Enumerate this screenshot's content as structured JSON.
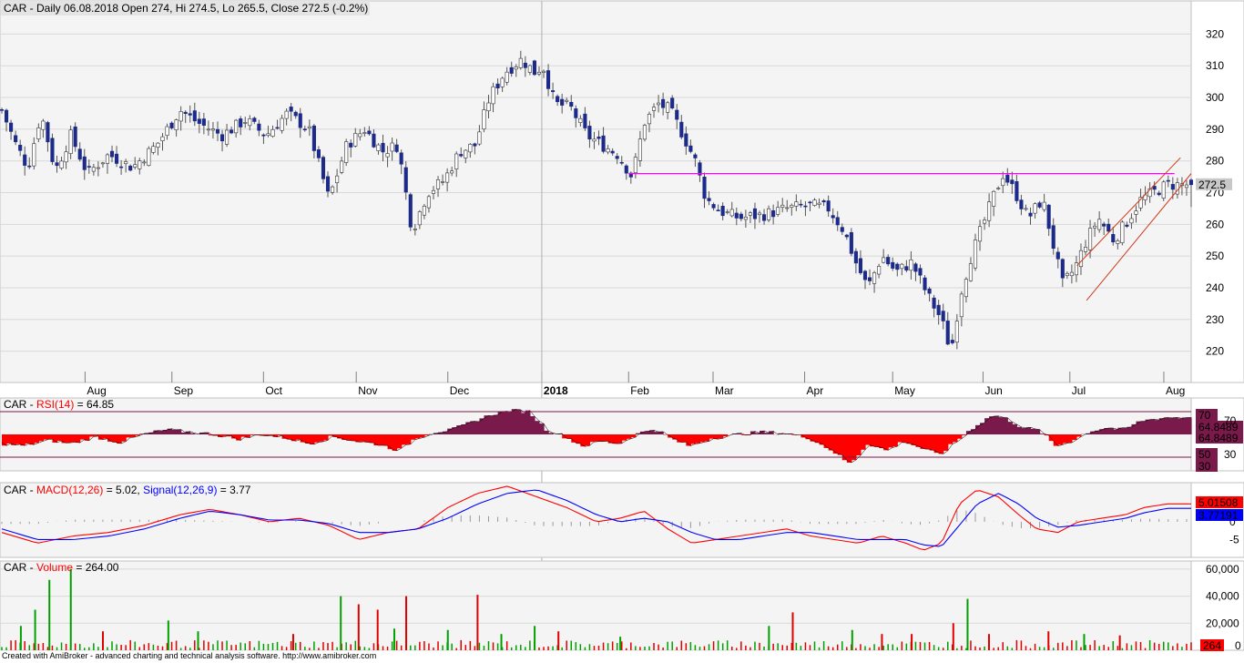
{
  "footer": {
    "text": "Created with AmiBroker - advanced charting and technical analysis software. http://www.amibroker.com"
  },
  "colors": {
    "bg": "#ffffff",
    "pane_bg": "#f4f4f4",
    "grid": "#d8d8d8",
    "candle_down": "#1c2a8a",
    "candle_up": "#ffffff",
    "wick": "#555555",
    "resistance": "#ff00ff",
    "channel": "#d03a1a",
    "rsi_fill_high": "#7a1a4a",
    "rsi_fill_low": "#ff0000",
    "macd": "#ff0000",
    "signal": "#0000ff",
    "vol_up": "#00a000",
    "vol_down": "#e00000"
  },
  "chart_data": [
    {
      "id": "price",
      "type": "candlestick",
      "title_parts": [
        {
          "text": "CAR - Daily 06.08.2018 Open 274, Hi 274.5, Lo 265.5, Close 272.5 (-0.2%)",
          "color": "#000000"
        }
      ],
      "ylim": [
        213,
        325
      ],
      "yticks": [
        220,
        230,
        240,
        250,
        260,
        270,
        280,
        290,
        300,
        310,
        320
      ],
      "months": [
        {
          "label": "Aug",
          "bold": false,
          "frac": 0.07
        },
        {
          "label": "Sep",
          "bold": false,
          "frac": 0.143
        },
        {
          "label": "Oct",
          "bold": false,
          "frac": 0.22
        },
        {
          "label": "Nov",
          "bold": false,
          "frac": 0.298
        },
        {
          "label": "Dec",
          "bold": false,
          "frac": 0.375
        },
        {
          "label": "2018",
          "bold": true,
          "frac": 0.454
        },
        {
          "label": "Feb",
          "bold": false,
          "frac": 0.527
        },
        {
          "label": "Mar",
          "bold": false,
          "frac": 0.598
        },
        {
          "label": "Apr",
          "bold": false,
          "frac": 0.675
        },
        {
          "label": "May",
          "bold": false,
          "frac": 0.749
        },
        {
          "label": "Jun",
          "bold": false,
          "frac": 0.825
        },
        {
          "label": "Jul",
          "bold": false,
          "frac": 0.898
        },
        {
          "label": "Aug",
          "bold": false,
          "frac": 0.977
        }
      ],
      "close_path": [
        [
          0.0,
          296
        ],
        [
          0.012,
          285
        ],
        [
          0.022,
          278
        ],
        [
          0.033,
          295
        ],
        [
          0.045,
          277
        ],
        [
          0.058,
          288
        ],
        [
          0.072,
          276
        ],
        [
          0.09,
          282
        ],
        [
          0.11,
          278
        ],
        [
          0.13,
          285
        ],
        [
          0.15,
          296
        ],
        [
          0.165,
          292
        ],
        [
          0.185,
          288
        ],
        [
          0.205,
          293
        ],
        [
          0.222,
          288
        ],
        [
          0.24,
          295
        ],
        [
          0.258,
          290
        ],
        [
          0.275,
          268
        ],
        [
          0.29,
          285
        ],
        [
          0.305,
          290
        ],
        [
          0.32,
          283
        ],
        [
          0.333,
          285
        ],
        [
          0.345,
          258
        ],
        [
          0.358,
          270
        ],
        [
          0.372,
          274
        ],
        [
          0.385,
          283
        ],
        [
          0.398,
          285
        ],
        [
          0.41,
          300
        ],
        [
          0.423,
          308
        ],
        [
          0.437,
          312
        ],
        [
          0.448,
          308
        ],
        [
          0.455,
          310
        ],
        [
          0.465,
          298
        ],
        [
          0.478,
          297
        ],
        [
          0.492,
          288
        ],
        [
          0.505,
          285
        ],
        [
          0.518,
          282
        ],
        [
          0.53,
          275
        ],
        [
          0.54,
          292
        ],
        [
          0.552,
          298
        ],
        [
          0.562,
          296
        ],
        [
          0.573,
          288
        ],
        [
          0.583,
          280
        ],
        [
          0.592,
          268
        ],
        [
          0.605,
          264
        ],
        [
          0.62,
          262
        ],
        [
          0.64,
          263
        ],
        [
          0.66,
          265
        ],
        [
          0.68,
          266
        ],
        [
          0.695,
          265
        ],
        [
          0.708,
          258
        ],
        [
          0.718,
          248
        ],
        [
          0.728,
          240
        ],
        [
          0.74,
          250
        ],
        [
          0.752,
          245
        ],
        [
          0.765,
          248
        ],
        [
          0.778,
          238
        ],
        [
          0.79,
          230
        ],
        [
          0.798,
          220
        ],
        [
          0.806,
          238
        ],
        [
          0.815,
          250
        ],
        [
          0.825,
          260
        ],
        [
          0.835,
          270
        ],
        [
          0.842,
          276
        ],
        [
          0.852,
          270
        ],
        [
          0.863,
          262
        ],
        [
          0.875,
          268
        ],
        [
          0.885,
          252
        ],
        [
          0.892,
          241
        ],
        [
          0.902,
          246
        ],
        [
          0.912,
          255
        ],
        [
          0.922,
          262
        ],
        [
          0.935,
          255
        ],
        [
          0.948,
          262
        ],
        [
          0.958,
          268
        ],
        [
          0.968,
          270
        ],
        [
          0.98,
          272.5
        ]
      ],
      "resistance": {
        "y": 276,
        "x_from_frac": 0.527,
        "x_to_frac": 0.986
      },
      "channel": [
        {
          "x0": 0.912,
          "y0": 236,
          "x1": 1.0,
          "y1": 276
        },
        {
          "x0": 0.904,
          "y0": 247,
          "x1": 0.991,
          "y1": 281
        }
      ],
      "last_price_label": "272.5"
    },
    {
      "id": "rsi",
      "type": "area",
      "title_parts": [
        {
          "text": "CAR - ",
          "color": "#000000"
        },
        {
          "text": "RSI(14)",
          "color": "#ff0000"
        },
        {
          "text": " = 64.85",
          "color": "#000000"
        }
      ],
      "ylim": [
        18,
        82
      ],
      "levels": [
        70,
        30
      ],
      "midline": 50,
      "path": [
        [
          0.0,
          42
        ],
        [
          0.02,
          40
        ],
        [
          0.04,
          45
        ],
        [
          0.06,
          42
        ],
        [
          0.08,
          48
        ],
        [
          0.1,
          43
        ],
        [
          0.12,
          50
        ],
        [
          0.14,
          54
        ],
        [
          0.16,
          52
        ],
        [
          0.18,
          50
        ],
        [
          0.2,
          46
        ],
        [
          0.22,
          50
        ],
        [
          0.24,
          47
        ],
        [
          0.26,
          42
        ],
        [
          0.28,
          48
        ],
        [
          0.3,
          44
        ],
        [
          0.32,
          41
        ],
        [
          0.335,
          36
        ],
        [
          0.35,
          47
        ],
        [
          0.365,
          52
        ],
        [
          0.38,
          54
        ],
        [
          0.4,
          62
        ],
        [
          0.415,
          68
        ],
        [
          0.43,
          71
        ],
        [
          0.445,
          70
        ],
        [
          0.46,
          54
        ],
        [
          0.475,
          48
        ],
        [
          0.49,
          40
        ],
        [
          0.505,
          44
        ],
        [
          0.52,
          42
        ],
        [
          0.535,
          50
        ],
        [
          0.55,
          55
        ],
        [
          0.565,
          46
        ],
        [
          0.58,
          40
        ],
        [
          0.6,
          47
        ],
        [
          0.62,
          50
        ],
        [
          0.64,
          52
        ],
        [
          0.66,
          51
        ],
        [
          0.68,
          47
        ],
        [
          0.7,
          36
        ],
        [
          0.715,
          24
        ],
        [
          0.73,
          42
        ],
        [
          0.745,
          36
        ],
        [
          0.76,
          44
        ],
        [
          0.775,
          38
        ],
        [
          0.79,
          32
        ],
        [
          0.805,
          45
        ],
        [
          0.82,
          57
        ],
        [
          0.835,
          67
        ],
        [
          0.848,
          63
        ],
        [
          0.86,
          56
        ],
        [
          0.875,
          53
        ],
        [
          0.888,
          40
        ],
        [
          0.9,
          44
        ],
        [
          0.915,
          52
        ],
        [
          0.93,
          56
        ],
        [
          0.945,
          54
        ],
        [
          0.96,
          62
        ],
        [
          0.98,
          64.85
        ]
      ],
      "labels": [
        "70",
        "64.8489",
        "64.8489",
        "50",
        "30",
        "30"
      ]
    },
    {
      "id": "macd",
      "type": "line",
      "title_parts": [
        {
          "text": "CAR - ",
          "color": "#000000"
        },
        {
          "text": "MACD(12,26)",
          "color": "#ff0000"
        },
        {
          "text": " = 5.02, ",
          "color": "#000000"
        },
        {
          "text": "Signal(12,26,9)",
          "color": "#0000ff"
        },
        {
          "text": " = 3.77",
          "color": "#000000"
        }
      ],
      "ylim": [
        -10,
        11
      ],
      "yticks": [
        5,
        0,
        -5
      ],
      "series": [
        {
          "name": "MACD(12,26)",
          "path": [
            [
              0.0,
              -3
            ],
            [
              0.03,
              -6
            ],
            [
              0.06,
              -4
            ],
            [
              0.09,
              -3
            ],
            [
              0.12,
              -1
            ],
            [
              0.15,
              2
            ],
            [
              0.175,
              3.5
            ],
            [
              0.2,
              2
            ],
            [
              0.225,
              0
            ],
            [
              0.25,
              1
            ],
            [
              0.275,
              -1
            ],
            [
              0.3,
              -5
            ],
            [
              0.325,
              -3
            ],
            [
              0.35,
              -2
            ],
            [
              0.375,
              4
            ],
            [
              0.4,
              8
            ],
            [
              0.425,
              10
            ],
            [
              0.45,
              7
            ],
            [
              0.475,
              4
            ],
            [
              0.5,
              0
            ],
            [
              0.52,
              1
            ],
            [
              0.54,
              3
            ],
            [
              0.56,
              -2
            ],
            [
              0.58,
              -6
            ],
            [
              0.6,
              -5
            ],
            [
              0.62,
              -4
            ],
            [
              0.64,
              -3
            ],
            [
              0.66,
              -2
            ],
            [
              0.68,
              -4
            ],
            [
              0.7,
              -5
            ],
            [
              0.72,
              -6
            ],
            [
              0.74,
              -4
            ],
            [
              0.76,
              -6
            ],
            [
              0.775,
              -8
            ],
            [
              0.79,
              -6
            ],
            [
              0.805,
              5
            ],
            [
              0.82,
              9
            ],
            [
              0.838,
              7
            ],
            [
              0.855,
              2
            ],
            [
              0.87,
              -2
            ],
            [
              0.888,
              -3
            ],
            [
              0.905,
              0
            ],
            [
              0.925,
              1
            ],
            [
              0.945,
              2
            ],
            [
              0.96,
              4
            ],
            [
              0.98,
              5.02
            ]
          ]
        },
        {
          "name": "Signal(12,26,9)",
          "path": [
            [
              0.0,
              -2
            ],
            [
              0.03,
              -5
            ],
            [
              0.06,
              -5
            ],
            [
              0.09,
              -4
            ],
            [
              0.12,
              -2
            ],
            [
              0.15,
              1
            ],
            [
              0.175,
              3
            ],
            [
              0.2,
              2
            ],
            [
              0.225,
              0.5
            ],
            [
              0.25,
              0.5
            ],
            [
              0.275,
              -0.5
            ],
            [
              0.3,
              -3
            ],
            [
              0.325,
              -3
            ],
            [
              0.35,
              -2
            ],
            [
              0.375,
              1
            ],
            [
              0.4,
              5
            ],
            [
              0.425,
              8
            ],
            [
              0.45,
              9
            ],
            [
              0.475,
              6
            ],
            [
              0.5,
              2
            ],
            [
              0.52,
              0
            ],
            [
              0.54,
              1
            ],
            [
              0.56,
              0
            ],
            [
              0.58,
              -3
            ],
            [
              0.6,
              -5
            ],
            [
              0.62,
              -5
            ],
            [
              0.64,
              -4
            ],
            [
              0.66,
              -3
            ],
            [
              0.68,
              -3
            ],
            [
              0.7,
              -4
            ],
            [
              0.72,
              -5
            ],
            [
              0.74,
              -5
            ],
            [
              0.76,
              -5
            ],
            [
              0.775,
              -6.5
            ],
            [
              0.79,
              -7
            ],
            [
              0.805,
              -1
            ],
            [
              0.82,
              5
            ],
            [
              0.838,
              8
            ],
            [
              0.855,
              5
            ],
            [
              0.87,
              1
            ],
            [
              0.888,
              -1.5
            ],
            [
              0.905,
              -1
            ],
            [
              0.925,
              0
            ],
            [
              0.945,
              1
            ],
            [
              0.96,
              2.5
            ],
            [
              0.98,
              3.77
            ]
          ]
        }
      ],
      "labels": [
        "5.01508",
        "3.77191"
      ]
    },
    {
      "id": "volume",
      "type": "bar",
      "title_parts": [
        {
          "text": "CAR - ",
          "color": "#000000"
        },
        {
          "text": "Volume",
          "color": "#ff0000"
        },
        {
          "text": " = 264.00",
          "color": "#000000"
        }
      ],
      "ylim": [
        0,
        66000
      ],
      "yticks": [
        60000,
        40000,
        20000,
        0
      ],
      "ytick_labels": [
        "60,000",
        "40,000",
        "20,000",
        "0"
      ],
      "spikes": [
        [
          0.016,
          18000,
          "up"
        ],
        [
          0.028,
          30000,
          "up"
        ],
        [
          0.04,
          52000,
          "up"
        ],
        [
          0.058,
          60000,
          "up"
        ],
        [
          0.085,
          14000,
          "down"
        ],
        [
          0.14,
          22000,
          "up"
        ],
        [
          0.165,
          14000,
          "up"
        ],
        [
          0.245,
          12000,
          "down"
        ],
        [
          0.285,
          40000,
          "up"
        ],
        [
          0.3,
          34000,
          "down"
        ],
        [
          0.316,
          30000,
          "down"
        ],
        [
          0.33,
          16000,
          "up"
        ],
        [
          0.34,
          40000,
          "down"
        ],
        [
          0.375,
          15000,
          "up"
        ],
        [
          0.4,
          41000,
          "down"
        ],
        [
          0.42,
          12000,
          "up"
        ],
        [
          0.448,
          18000,
          "up"
        ],
        [
          0.468,
          14000,
          "down"
        ],
        [
          0.52,
          10000,
          "up"
        ],
        [
          0.645,
          18000,
          "up"
        ],
        [
          0.665,
          28000,
          "down"
        ],
        [
          0.715,
          15000,
          "up"
        ],
        [
          0.74,
          12000,
          "down"
        ],
        [
          0.765,
          12000,
          "down"
        ],
        [
          0.8,
          20000,
          "down"
        ],
        [
          0.812,
          38000,
          "up"
        ],
        [
          0.83,
          12000,
          "down"
        ],
        [
          0.88,
          14000,
          "down"
        ],
        [
          0.91,
          12000,
          "up"
        ],
        [
          0.94,
          11000,
          "down"
        ]
      ],
      "last_label": "264"
    }
  ]
}
